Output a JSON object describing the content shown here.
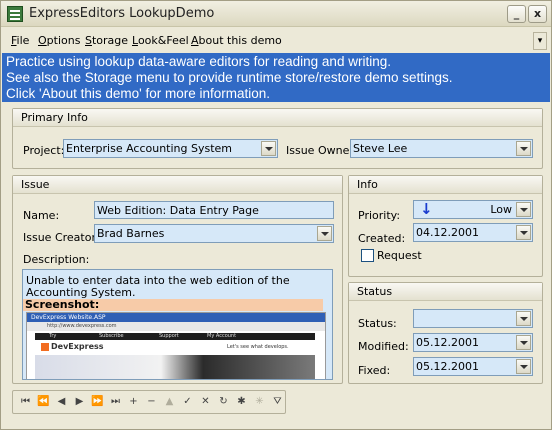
{
  "window": {
    "title": "ExpressEditors LookupDemo",
    "min_label": "_",
    "close_label": "x"
  },
  "menu": {
    "items": [
      {
        "u": "F",
        "rest": "ile"
      },
      {
        "u": "O",
        "rest": "ptions"
      },
      {
        "u": "S",
        "rest": "torage"
      },
      {
        "u": "L",
        "rest": "ook&Feel"
      },
      {
        "u": "A",
        "rest": "bout this demo"
      }
    ],
    "chevron": "▾"
  },
  "banner": {
    "line1": "Practice using lookup data-aware editors for reading and writing.",
    "line2": "See also the Storage menu to provide runtime store/restore demo settings.",
    "line3": "Click 'About this demo' for more information."
  },
  "primary_info": {
    "header": "Primary Info",
    "project_label": "Project:",
    "project_value": "Enterprise Accounting System",
    "owner_label": "Issue Owner:",
    "owner_value": "Steve Lee"
  },
  "issue": {
    "header": "Issue",
    "name_label": "Name:",
    "name_value": "Web Edition: Data Entry Page",
    "creator_label": "Issue Creator:",
    "creator_value": "Brad Barnes",
    "description_label": "Description:",
    "description_text": "Unable to enter data into the web edition of the Accounting System.",
    "screenshot_heading": "Screenshot:",
    "shot": {
      "tab_title": "DevExpress Website.ASP",
      "url": "http://www.devexpress.com",
      "logo": "DevExpress",
      "tagline": "Let's see what develops.",
      "nav": [
        "Try",
        "Subscribe",
        "Support",
        "My Account"
      ]
    }
  },
  "info": {
    "header": "Info",
    "priority_label": "Priority:",
    "priority_value": "Low",
    "created_label": "Created:",
    "created_value": "04.12.2001",
    "request_label": "Request",
    "request_checked": false
  },
  "status": {
    "header": "Status",
    "status_label": "Status:",
    "status_value": "",
    "modified_label": "Modified:",
    "modified_value": "05.12.2001",
    "fixed_label": "Fixed:",
    "fixed_value": "05.12.2001"
  },
  "navigator": {
    "buttons": [
      {
        "name": "nav-first-button",
        "glyph": "⏮",
        "enabled": true
      },
      {
        "name": "nav-prev-page-button",
        "glyph": "⏪",
        "enabled": true
      },
      {
        "name": "nav-prev-button",
        "glyph": "◀",
        "enabled": true
      },
      {
        "name": "nav-next-button",
        "glyph": "▶",
        "enabled": true
      },
      {
        "name": "nav-next-page-button",
        "glyph": "⏩",
        "enabled": true
      },
      {
        "name": "nav-last-button",
        "glyph": "⏭",
        "enabled": true
      },
      {
        "name": "nav-insert-button",
        "glyph": "+",
        "enabled": true
      },
      {
        "name": "nav-delete-button",
        "glyph": "−",
        "enabled": true
      },
      {
        "name": "nav-edit-button",
        "glyph": "▲",
        "enabled": false
      },
      {
        "name": "nav-post-button",
        "glyph": "✓",
        "enabled": true
      },
      {
        "name": "nav-cancel-button",
        "glyph": "✕",
        "enabled": true
      },
      {
        "name": "nav-refresh-button",
        "glyph": "↻",
        "enabled": true
      },
      {
        "name": "nav-bookmark-button",
        "glyph": "✱",
        "enabled": true
      },
      {
        "name": "nav-goto-bookmark-button",
        "glyph": "✳",
        "enabled": false
      },
      {
        "name": "nav-filter-button",
        "glyph": "⛛",
        "enabled": true
      }
    ]
  },
  "colors": {
    "field_bg": "#d6e8f8",
    "banner_bg": "#316ac5",
    "header_peach": "#f7cba8",
    "arrow_blue": "#1a3ccf"
  }
}
